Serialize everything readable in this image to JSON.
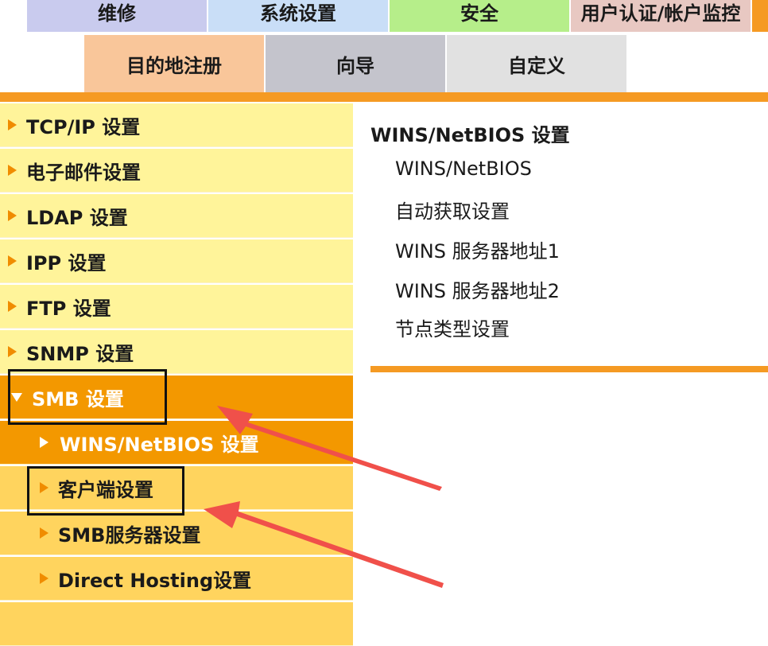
{
  "top_tabs_row1": [
    {
      "label": "维修",
      "color": "#c9cbee"
    },
    {
      "label": "系统设置",
      "color": "#c9def7"
    },
    {
      "label": "安全",
      "color": "#b6ee8a"
    },
    {
      "label": "用户认证/帐户监控",
      "color": "#e8c8c2"
    }
  ],
  "top_tabs_row2": [
    {
      "label": "目的地注册",
      "color": "#f9c69a"
    },
    {
      "label": "向导",
      "color": "#c4c4cc"
    },
    {
      "label": "自定义",
      "color": "#e1e1e1"
    }
  ],
  "sidebar": {
    "items": [
      {
        "label": "TCP/IP 设置"
      },
      {
        "label": "电子邮件设置"
      },
      {
        "label": "LDAP 设置"
      },
      {
        "label": "IPP 设置"
      },
      {
        "label": "FTP 设置"
      },
      {
        "label": "SNMP 设置"
      },
      {
        "label": "SMB 设置"
      }
    ],
    "sub_items": [
      {
        "label": "WINS/NetBIOS 设置"
      },
      {
        "label": "客户端设置"
      },
      {
        "label": "SMB服务器设置"
      },
      {
        "label": "Direct Hosting设置"
      }
    ]
  },
  "content": {
    "title": "WINS/NetBIOS 设置",
    "items": [
      "WINS/NetBIOS",
      "自动获取设置",
      "WINS 服务器地址1",
      "WINS 服务器地址2",
      "节点类型设置"
    ]
  },
  "colors": {
    "accent": "#f39800",
    "sidebar_level1": "#fff49a",
    "sidebar_level2": "#ffd45e",
    "annotation_arrow": "#f0504a"
  }
}
